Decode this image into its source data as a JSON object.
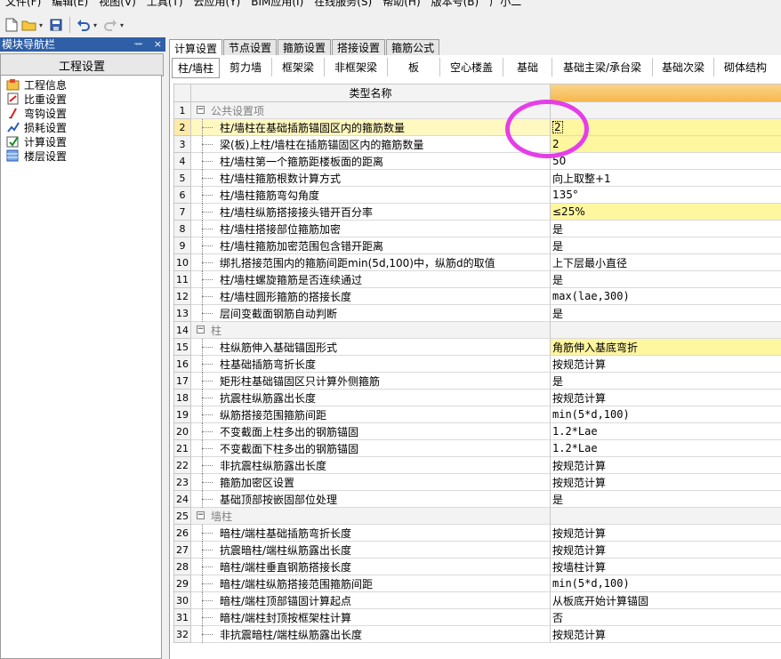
{
  "menu": [
    "文件(F)",
    "编辑(E)",
    "视图(V)",
    "工具(T)",
    "云应用(Y)",
    "BIM应用(I)",
    "在线服务(S)",
    "帮助(H)",
    "版本号(B)",
    "广小二"
  ],
  "nav": {
    "title": "模块导航栏",
    "pin": "ᅲ",
    "close": "×",
    "section_button": "工程设置",
    "items": [
      "工程信息",
      "比重设置",
      "弯钩设置",
      "损耗设置",
      "计算设置",
      "楼层设置"
    ]
  },
  "tabs_top": [
    "计算设置",
    "节点设置",
    "箍筋设置",
    "搭接设置",
    "箍筋公式"
  ],
  "tabs_sub": [
    "柱/墙柱",
    "剪力墙",
    "框架梁",
    "非框架梁",
    "板",
    "空心楼盖",
    "基础",
    "基础主梁/承台梁",
    "基础次梁",
    "砌体结构"
  ],
  "grid": {
    "header": "类型名称",
    "rows": [
      {
        "n": "1",
        "name": "公共设置项",
        "value": "",
        "group": true
      },
      {
        "n": "2",
        "name": "柱/墙柱在基础插筋锚固区内的箍筋数量",
        "value": "2",
        "highlight": true,
        "selected": true
      },
      {
        "n": "3",
        "name": "梁(板)上柱/墙柱在插筋锚固区内的箍筋数量",
        "value": "2",
        "highlight": true
      },
      {
        "n": "4",
        "name": "柱/墙柱第一个箍筋距楼板面的距离",
        "value": "50"
      },
      {
        "n": "5",
        "name": "柱/墙柱箍筋根数计算方式",
        "value": "向上取整+1"
      },
      {
        "n": "6",
        "name": "柱/墙柱箍筋弯勾角度",
        "value": "135°"
      },
      {
        "n": "7",
        "name": "柱/墙柱纵筋搭接接头错开百分率",
        "value": "≤25%",
        "highlight": true
      },
      {
        "n": "8",
        "name": "柱/墙柱搭接部位箍筋加密",
        "value": "是"
      },
      {
        "n": "9",
        "name": "柱/墙柱箍筋加密范围包含错开距离",
        "value": "是"
      },
      {
        "n": "10",
        "name": "绑扎搭接范围内的箍筋间距min(5d,100)中，纵筋d的取值",
        "value": "上下层最小直径"
      },
      {
        "n": "11",
        "name": "柱/墙柱螺旋箍筋是否连续通过",
        "value": "是"
      },
      {
        "n": "12",
        "name": "柱/墙柱圆形箍筋的搭接长度",
        "value": "max(lae,300)",
        "mono": true
      },
      {
        "n": "13",
        "name": "层间变截面钢筋自动判断",
        "value": "是"
      },
      {
        "n": "14",
        "name": "柱",
        "value": "",
        "group": true
      },
      {
        "n": "15",
        "name": "柱纵筋伸入基础锚固形式",
        "value": "角筋伸入基底弯折",
        "highlight": true
      },
      {
        "n": "16",
        "name": "柱基础插筋弯折长度",
        "value": "按规范计算"
      },
      {
        "n": "17",
        "name": "矩形柱基础锚固区只计算外侧箍筋",
        "value": "是"
      },
      {
        "n": "18",
        "name": "抗震柱纵筋露出长度",
        "value": "按规范计算"
      },
      {
        "n": "19",
        "name": "纵筋搭接范围箍筋间距",
        "value": "min(5*d,100)",
        "mono": true
      },
      {
        "n": "20",
        "name": "不变截面上柱多出的钢筋锚固",
        "value": "1.2*Lae",
        "mono": true
      },
      {
        "n": "21",
        "name": "不变截面下柱多出的钢筋锚固",
        "value": "1.2*Lae",
        "mono": true
      },
      {
        "n": "22",
        "name": "非抗震柱纵筋露出长度",
        "value": "按规范计算"
      },
      {
        "n": "23",
        "name": "箍筋加密区设置",
        "value": "按规范计算"
      },
      {
        "n": "24",
        "name": "基础顶部按嵌固部位处理",
        "value": "是"
      },
      {
        "n": "25",
        "name": "墙柱",
        "value": "",
        "group": true
      },
      {
        "n": "26",
        "name": "暗柱/端柱基础插筋弯折长度",
        "value": "按规范计算"
      },
      {
        "n": "27",
        "name": "抗震暗柱/端柱纵筋露出长度",
        "value": "按规范计算"
      },
      {
        "n": "28",
        "name": "暗柱/端柱垂直钢筋搭接长度",
        "value": "按墙柱计算"
      },
      {
        "n": "29",
        "name": "暗柱/端柱纵筋搭接范围箍筋间距",
        "value": "min(5*d,100)",
        "mono": true
      },
      {
        "n": "30",
        "name": "暗柱/端柱顶部锚固计算起点",
        "value": "从板底开始计算锚固"
      },
      {
        "n": "31",
        "name": "暗柱/端柱封顶按框架柱计算",
        "value": "否"
      },
      {
        "n": "32",
        "name": "非抗震暗柱/端柱纵筋露出长度",
        "value": "按规范计算"
      }
    ]
  },
  "colors": {
    "annotation_circle": "#e53ee8",
    "highlight": "#fff6a0",
    "header_value_col": "#f6b84d",
    "nav_title": "#2f5fa7"
  }
}
